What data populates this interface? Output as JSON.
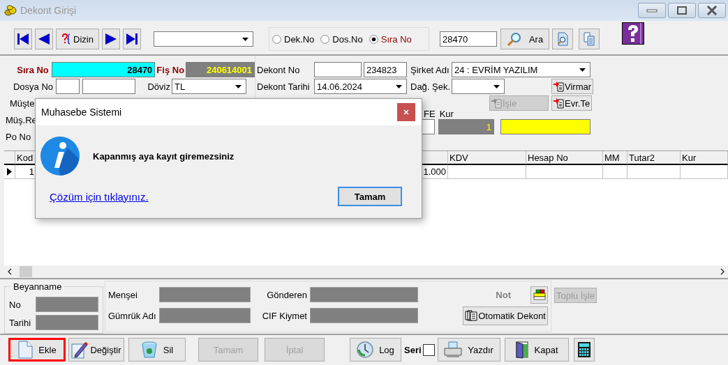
{
  "window": {
    "title": "Dekont Girişi"
  },
  "toolbar": {
    "index_button": "Dizin",
    "search_by": [
      {
        "label": "Dek.No",
        "selected": false
      },
      {
        "label": "Dos.No",
        "selected": false
      },
      {
        "label": "Sıra No",
        "selected": true
      }
    ],
    "search_value": "28470",
    "search_button": "Ara"
  },
  "header": {
    "sira_no": {
      "label": "Sıra No",
      "value": "28470"
    },
    "fis_no": {
      "label": "Fiş No",
      "value": "240614001"
    },
    "dosya_no": {
      "label": "Dosya No"
    },
    "doviz": {
      "label": "Döviz",
      "value": "TL"
    },
    "musteri": {
      "label": "Müşte"
    },
    "mus_ref": {
      "label": "Müş.Re"
    },
    "po_no": {
      "label": "Po No"
    },
    "dekont_no": {
      "label": "Dekont No",
      "value": "234823"
    },
    "dekont_tarihi": {
      "label": "Dekont Tarihi",
      "value": "14.06.2024"
    },
    "sirket_adi": {
      "label": "Şirket Adı",
      "value": "24 : EVRİM YAZILIM"
    },
    "dag_sek": {
      "label": "Dağ. Şek."
    },
    "virman_button": "Virmar",
    "isle_button": {
      "label": "İşle",
      "disabled": true
    },
    "evr_button": "Evr.Te",
    "fe_label": "FE",
    "kur": {
      "label": "Kur",
      "value": "1"
    }
  },
  "grid": {
    "columns": [
      {
        "label": "Kod"
      },
      {
        "label": "KDV"
      },
      {
        "label": "Hesap No"
      },
      {
        "label": "MM"
      },
      {
        "label": "Tutar2"
      },
      {
        "label": "Kur"
      }
    ],
    "rows": [
      {
        "current": true,
        "kod": "1",
        "amount": "1.000"
      }
    ]
  },
  "customs": {
    "group_title": "Beyanname",
    "no_label": "No",
    "date_label": "Tarihi",
    "origin_label": "Menşei",
    "customs_label": "Gümrük Adı",
    "sender_label": "Gönderen",
    "cif_label": "CIF Kiymet",
    "note_label": "Not",
    "auto_button": "Otomatik Dekont",
    "bulk_button": {
      "label": "Toplu İşle",
      "disabled": true
    }
  },
  "actions": [
    {
      "kind": "new",
      "label": "Ekle",
      "disabled": false,
      "highlighted": true
    },
    {
      "kind": "edit",
      "label": "Değiştir",
      "disabled": false,
      "highlighted": false
    },
    {
      "kind": "delete",
      "label": "Sil",
      "disabled": false,
      "highlighted": false
    },
    {
      "kind": "confirm",
      "label": "Tamam",
      "disabled": true,
      "highlighted": false
    },
    {
      "kind": "cancel",
      "label": "İptal",
      "disabled": true,
      "highlighted": false
    },
    {
      "kind": "log",
      "label": "Log",
      "disabled": false,
      "highlighted": false
    },
    {
      "kind": "checkbox",
      "label": "Seri",
      "checked": false
    },
    {
      "kind": "print",
      "label": "Yazdır",
      "disabled": false,
      "highlighted": false
    },
    {
      "kind": "close",
      "label": "Kapat",
      "disabled": false,
      "highlighted": false
    },
    {
      "kind": "calculator",
      "disabled": false,
      "highlighted": false
    }
  ],
  "dialog": {
    "title": "Muhasebe Sistemi",
    "message": "Kapanmış aya kayıt giremezsiniz",
    "link": "Çözüm için tıklayınız.",
    "button": "Tamam"
  }
}
